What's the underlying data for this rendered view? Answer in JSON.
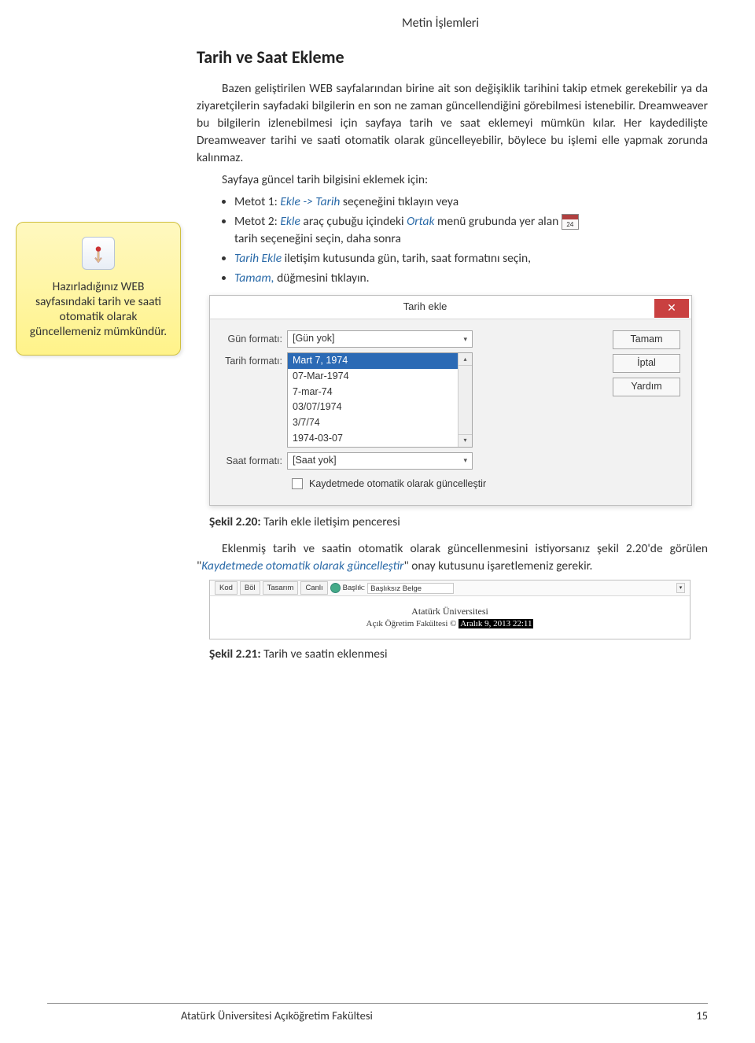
{
  "header": {
    "doc_title": "Metin İşlemleri"
  },
  "section": {
    "title": "Tarih ve Saat Ekleme"
  },
  "callout": {
    "text": "Hazırladığınız WEB sayfasındaki tarih ve saati otomatik olarak güncellemeniz mümkündür.",
    "icon_name": "pointer-hand-icon"
  },
  "body": {
    "p1": "Bazen geliştirilen WEB sayfalarından birine ait son değişiklik tarihini takip etmek gerekebilir ya da ziyaretçilerin sayfadaki bilgilerin en son ne zaman güncellendiğini görebilmesi istenebilir. Dreamweaver bu bilgilerin izlenebilmesi için sayfaya tarih ve saat eklemeyi mümkün kılar. Her kaydedilişte Dreamweaver tarihi ve saati otomatik olarak güncelleyebilir, böylece bu işlemi elle yapmak zorunda kalınmaz.",
    "p2_lead": "Sayfaya güncel tarih bilgisini eklemek için:",
    "li1_pre": "Metot 1: ",
    "li1_em": "Ekle -> Tarih",
    "li1_post": " seçeneğini tıklayın veya",
    "li2_pre": "Metot 2: ",
    "li2_em1": "Ekle",
    "li2_mid": " araç çubuğu içindeki ",
    "li2_em2": "Ortak",
    "li2_post": " menü grubunda yer alan ",
    "li2_tail": "tarih seçeneğini seçin, daha sonra",
    "li3_em": "Tarih Ekle",
    "li3_post": " iletişim kutusunda gün, tarih, saat formatını seçin,",
    "li4_em": "Tamam,",
    "li4_post": " düğmesini tıklayın."
  },
  "dialog": {
    "title": "Tarih ekle",
    "close_glyph": "✕",
    "labels": {
      "day": "Gün formatı:",
      "date": "Tarih formatı:",
      "time": "Saat formatı:"
    },
    "day_value": "[Gün yok]",
    "date_options": [
      "Mart 7, 1974",
      "07-Mar-1974",
      "7-mar-74",
      "03/07/1974",
      "3/7/74",
      "1974-03-07"
    ],
    "time_value": "[Saat yok]",
    "buttons": {
      "ok": "Tamam",
      "cancel": "İptal",
      "help": "Yardım"
    },
    "checkbox_label": "Kaydetmede otomatik olarak güncelleştir"
  },
  "fig220": {
    "label": "Şekil 2.20:",
    "text": " Tarih ekle iletişim penceresi"
  },
  "after_p1": "Eklenmiş tarih ve saatin otomatik olarak güncellenmesini istiyorsanız şekil 2.20'de görülen \"",
  "after_em": "Kaydetmede otomatik olarak güncelleştir",
  "after_p2": "\" onay kutusunu işaretlemeniz gerekir.",
  "toolbar": {
    "tabs": [
      "Kod",
      "Böl",
      "Tasarım",
      "Canlı"
    ],
    "title_label": "Başlık:",
    "title_value": "Başlıksız Belge",
    "line1": "Atatürk Üniversitesi",
    "line2_pre": "Açık Öğretim Fakültesi © ",
    "line2_date": "Aralık 9, 2013 22:11"
  },
  "fig221": {
    "label": "Şekil 2.21:",
    "text": " Tarih ve saatin eklenmesi"
  },
  "footer": {
    "left": "Atatürk Üniversitesi Açıköğretim Fakültesi",
    "right": "15"
  }
}
